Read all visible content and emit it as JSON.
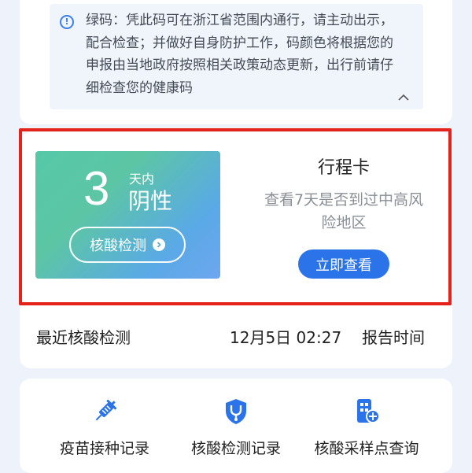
{
  "notice": {
    "icon": "info-icon",
    "text": "绿码：凭此码可在浙江省范围内通行，请主动出示，配合检查；并做好自身防护工作，码颜色将根据您的申报由当地政府按照相关政策动态更新，出行前请仔细检查您的健康码",
    "collapse_icon": "chevron-up-icon"
  },
  "test_panel": {
    "days": "3",
    "days_unit": "天内",
    "result": "阴性",
    "button_label": "核酸检测"
  },
  "trip_card": {
    "title": "行程卡",
    "description": "查看7天是否到过中高风险地区",
    "button_label": "立即查看"
  },
  "recent_test": {
    "label": "最近核酸检测",
    "time": "12月5日 02:27",
    "suffix": "报告时间"
  },
  "services": [
    {
      "label": "疫苗接种记录",
      "icon": "syringe-icon"
    },
    {
      "label": "核酸检测记录",
      "icon": "stethoscope-shield-icon"
    },
    {
      "label": "核酸采样点查询",
      "icon": "hospital-location-icon"
    }
  ],
  "colors": {
    "accent": "#2b73e8",
    "highlight": "#e52219",
    "background": "#eef3fb"
  }
}
